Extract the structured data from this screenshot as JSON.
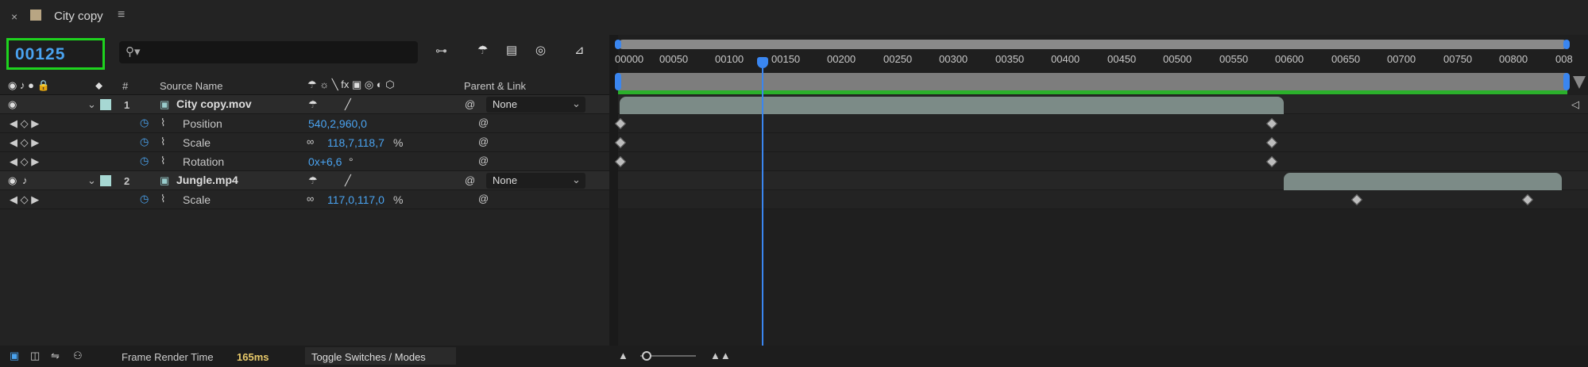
{
  "app": {
    "title": "City copy"
  },
  "timecode": {
    "value": "00125"
  },
  "search": {
    "placeholder": ""
  },
  "columns": {
    "source_name": "Source Name",
    "number": "#",
    "parent_link": "Parent & Link"
  },
  "layers": [
    {
      "index": "1",
      "name": "City copy.mov",
      "parent": "None",
      "label_color": "#a7d8d3",
      "properties": [
        {
          "name": "Position",
          "value_a": "540,2,960,0",
          "value_b": ""
        },
        {
          "name": "Scale",
          "value_a": "118,7,118,7",
          "value_b": "%"
        },
        {
          "name": "Rotation",
          "value_a": "0x+6,6",
          "value_b": "°"
        }
      ]
    },
    {
      "index": "2",
      "name": "Jungle.mp4",
      "parent": "None",
      "label_color": "#a7d8d3",
      "properties": [
        {
          "name": "Scale",
          "value_a": "117,0,117,0",
          "value_b": "%"
        }
      ]
    }
  ],
  "ruler": {
    "ticks": [
      "00000",
      "00050",
      "00100",
      "00150",
      "00200",
      "00250",
      "00300",
      "00350",
      "00400",
      "00450",
      "00500",
      "00550",
      "00600",
      "00650",
      "00700",
      "00750",
      "00800",
      "008"
    ]
  },
  "footer": {
    "frame_render_label": "Frame Render Time",
    "frame_render_value": "165ms",
    "toggle_label": "Toggle Switches / Modes"
  },
  "colors": {
    "accent": "#4aa3f0",
    "timecode_border": "#1ed31e",
    "layer_bar": "#7c8b87",
    "cache_green": "#2bb02b"
  }
}
